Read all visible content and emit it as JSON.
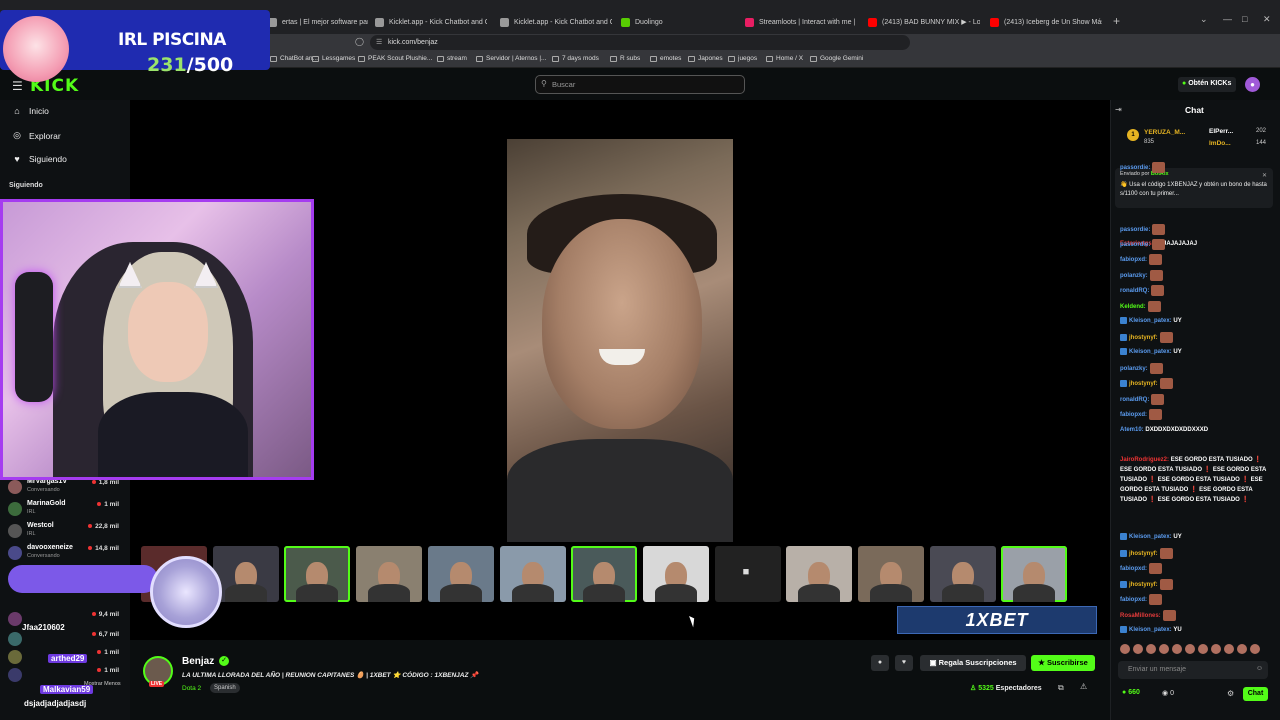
{
  "browser": {
    "tabs": [
      {
        "label": "ertas | El mejor software para pote...",
        "color": "#999999"
      },
      {
        "label": "Kicklet.app - Kick Chatbot and Overl...",
        "color": "#999999"
      },
      {
        "label": "Kicklet.app - Kick Chatbot and Overl...",
        "color": "#999999"
      },
      {
        "label": "Duolingo",
        "color": "#58cc02"
      },
      {
        "label": "Streamloots | Interact with me | Balig...",
        "color": "#e91e63"
      },
      {
        "label": "(2413) BAD BUNNY MIX ▶ - Lo Mej...",
        "color": "#ff0000"
      },
      {
        "label": "(2413) Iceberg de Un Show Más - Yo...",
        "color": "#ff0000"
      }
    ],
    "new_tab": "+",
    "url": "kick.com/benjaz",
    "bookmarks": [
      "ChatBot an...",
      "Lessgames",
      "PEAK Scout Plushie...",
      "stream",
      "Servidor | Aternos |...",
      "7 days mods",
      "R subs",
      "emotes",
      "Japones",
      "juegos",
      "Home / X",
      "Google Gemini"
    ]
  },
  "header": {
    "logo": "KICK",
    "search_placeholder": "Buscar",
    "kicks_label": "Obtén",
    "kicks_brand": "KICKs"
  },
  "sidebar": {
    "nav": [
      {
        "label": "Inicio",
        "icon": "home-icon"
      },
      {
        "label": "Explorar",
        "icon": "compass-icon"
      },
      {
        "label": "Siguiendo",
        "icon": "heart-icon"
      }
    ],
    "following_heading": "Siguiendo",
    "channels": [
      {
        "name": "MrVargas1V",
        "game": "Conversando",
        "viewers": "1,8 mil"
      },
      {
        "name": "MarinaGold",
        "game": "IRL",
        "viewers": "1 mil"
      },
      {
        "name": "Westcol",
        "game": "IRL",
        "viewers": "22,8 mil"
      },
      {
        "name": "davooxeneize",
        "game": "Conversando",
        "viewers": "14,8 mil"
      },
      {
        "name": "",
        "game": "",
        "viewers": "9,4 mil"
      },
      {
        "name": "",
        "game": "",
        "viewers": "6,7 mil"
      },
      {
        "name": "",
        "game": "",
        "viewers": "1 mil"
      },
      {
        "name": "",
        "game": "",
        "viewers": "1 mil"
      }
    ],
    "show_less": "Mostrar Menos"
  },
  "stream_overlay": {
    "title": "IRL PISCINA",
    "count_current": "231",
    "count_total": "/500",
    "users": [
      "Jfaa210602",
      "arthed29",
      "Malkavian59",
      "dsjadjadjadjasdj"
    ]
  },
  "player": {
    "promo_text": "1XBET"
  },
  "streamer": {
    "name": "Benjaz",
    "live_badge": "LIVE",
    "title": "LA ULTIMA LLORADA DEL AÑO | REUNION CAPITANES 🥚 | 1XBET ⭐ CÓDIGO : 1XBENJAZ 📌",
    "category": "Dota 2",
    "language": "Spanish",
    "gift_label": "Regala Suscripciones",
    "subscribe_label": "Suscribirse",
    "viewers_count": "5325",
    "viewers_label": "Espectadores"
  },
  "chat": {
    "title": "Chat",
    "pinned_top": [
      {
        "name": "YERUZA_M...",
        "value": "835"
      },
      {
        "name": "ElPerr...",
        "value": "202"
      },
      {
        "name": "ImDo...",
        "value": "144"
      }
    ],
    "bot_header_prefix": "Enviado por",
    "bot_name": "BotRix",
    "bot_message": "👋 Usa el código 1XBENJAZ y obtén un bono de hasta s/1100 con tu primer...",
    "messages": [
      {
        "user": "passordie:",
        "color": "#5b9cf0",
        "text": "",
        "emote": true,
        "badge": false
      },
      {
        "user": "passordie:",
        "color": "#5b9cf0",
        "text": "",
        "emote": true,
        "badge": false
      },
      {
        "user": "Estoriertgs:",
        "color": "#e33b3b",
        "text": "JAJAJAJAJAJ",
        "emote": false,
        "badge": false
      },
      {
        "user": "passordie:",
        "color": "#5b9cf0",
        "text": "",
        "emote": true,
        "badge": false
      },
      {
        "user": "fabiopxd:",
        "color": "#5b9cf0",
        "text": "",
        "emote": true,
        "badge": false
      },
      {
        "user": "polanzky:",
        "color": "#5b9cf0",
        "text": "",
        "emote": true,
        "badge": false
      },
      {
        "user": "ronaldRQ:",
        "color": "#5b9cf0",
        "text": "",
        "emote": true,
        "badge": false
      },
      {
        "user": "Keldend:",
        "color": "#53fc18",
        "text": "",
        "emote": true,
        "badge": false
      },
      {
        "user": "Kleison_patex:",
        "color": "#5b9cf0",
        "text": "UY",
        "emote": false,
        "badge": true
      },
      {
        "user": "jhostynyf:",
        "color": "#e6b422",
        "text": "",
        "emote": true,
        "badge": true
      },
      {
        "user": "Kleison_patex:",
        "color": "#5b9cf0",
        "text": "UY",
        "emote": false,
        "badge": true
      },
      {
        "user": "polanzky:",
        "color": "#5b9cf0",
        "text": "",
        "emote": true,
        "badge": false
      },
      {
        "user": "jhostynyf:",
        "color": "#e6b422",
        "text": "",
        "emote": true,
        "badge": true
      },
      {
        "user": "ronaldRQ:",
        "color": "#5b9cf0",
        "text": "",
        "emote": true,
        "badge": false
      },
      {
        "user": "fabiopxd:",
        "color": "#5b9cf0",
        "text": "",
        "emote": true,
        "badge": false
      },
      {
        "user": "Atem10:",
        "color": "#5b9cf0",
        "text": "DXDDXDXDXDDXXXD",
        "emote": false,
        "badge": false
      }
    ],
    "spam_user": "JairoRodriguez2:",
    "spam_text": "ESE GORDO ESTA TUSIADO ❗ ESE GORDO ESTA TUSIADO ❗ ESE GORDO ESTA TUSIADO ❗ ESE GORDO ESTA TUSIADO ❗ ESE GORDO ESTA TUSIADO ❗ ESE GORDO ESTA TUSIADO ❗ ESE GORDO ESTA TUSIADO ❗",
    "messages2": [
      {
        "user": "Kleison_patex:",
        "color": "#5b9cf0",
        "text": "UY",
        "emote": false,
        "badge": true
      },
      {
        "user": "jhostynyf:",
        "color": "#e6b422",
        "text": "",
        "emote": true,
        "badge": true
      },
      {
        "user": "fabiopxd:",
        "color": "#5b9cf0",
        "text": "",
        "emote": true,
        "badge": false
      },
      {
        "user": "jhostynyf:",
        "color": "#e6b422",
        "text": "",
        "emote": true,
        "badge": true
      },
      {
        "user": "fabiopxd:",
        "color": "#5b9cf0",
        "text": "",
        "emote": true,
        "badge": false
      },
      {
        "user": "RosaMillones:",
        "color": "#e33b3b",
        "text": "",
        "emote": true,
        "badge": false
      },
      {
        "user": "Kleison_patex:",
        "color": "#5b9cf0",
        "text": "YU",
        "emote": false,
        "badge": true
      }
    ],
    "input_placeholder": "Enviar un mensaje",
    "kicks_balance": "660",
    "points": "0",
    "send_label": "Chat"
  }
}
